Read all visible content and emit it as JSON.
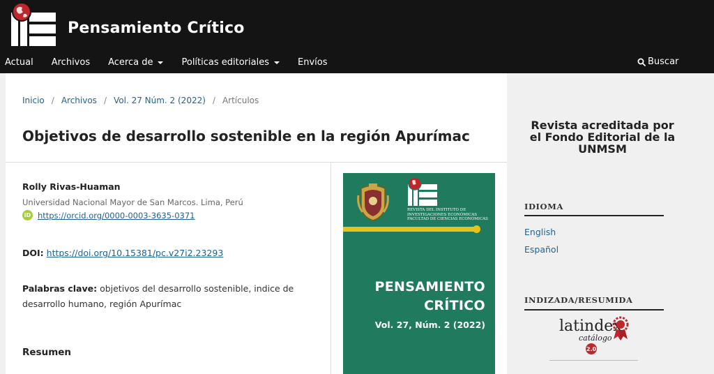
{
  "header": {
    "site_title": "Pensamiento Crítico",
    "nav": [
      {
        "label": "Actual",
        "has_dropdown": false
      },
      {
        "label": "Archivos",
        "has_dropdown": false
      },
      {
        "label": "Acerca de",
        "has_dropdown": true
      },
      {
        "label": "Políticas editoriales",
        "has_dropdown": true
      },
      {
        "label": "Envíos",
        "has_dropdown": false
      }
    ],
    "search_label": "Buscar",
    "logo_icon": "iie-globe-logo",
    "colors": {
      "background": "#141414",
      "text": "#ffffff"
    }
  },
  "breadcrumb": {
    "items": [
      "Inicio",
      "Archivos",
      "Vol. 27 Núm. 2 (2022)"
    ],
    "current": "Artículos"
  },
  "article": {
    "title": "Objetivos de desarrollo sostenible en la región Apurímac",
    "author": "Rolly Rivas-Huaman",
    "affiliation": "Universidad Nacional Mayor de San Marcos. Lima, Perú",
    "orcid_url": "https://orcid.org/0000-0003-3635-0371",
    "doi_label": "DOI:",
    "doi_url": "https://doi.org/10.15381/pc.v27i2.23293",
    "keywords_label": "Palabras clave:",
    "keywords": "objetivos del desarrollo sostenible, indice de desarrollo humano, región Apurímac",
    "abstract_heading": "Resumen"
  },
  "cover": {
    "institution_lines": [
      "REVISTA DEL INSTITUTO DE",
      "INVESTIGACIONES ECONÓMICAS",
      "FACULTAD DE CIENCIAS ECONÓMICAS"
    ],
    "title_line1": "PENSAMIENTO",
    "title_line2": "CRÍTICO",
    "volume": "Vol. 27, Núm. 2 (2022)",
    "colors": {
      "background": "#1f7a5e",
      "bar": "#e8c21a"
    }
  },
  "sidebar": {
    "accreditation": "Revista acreditada por el Fondo Editorial de la UNMSM",
    "language_title": "IDIOMA",
    "languages": [
      "English",
      "Español"
    ],
    "indexed_title": "INDIZADA/RESUMIDA",
    "latindex_text": "latindex",
    "latindex_sub": "catálogo",
    "latindex_version": "2.0"
  },
  "colors": {
    "link": "#1e6292",
    "orcid": "#a6ce39"
  }
}
